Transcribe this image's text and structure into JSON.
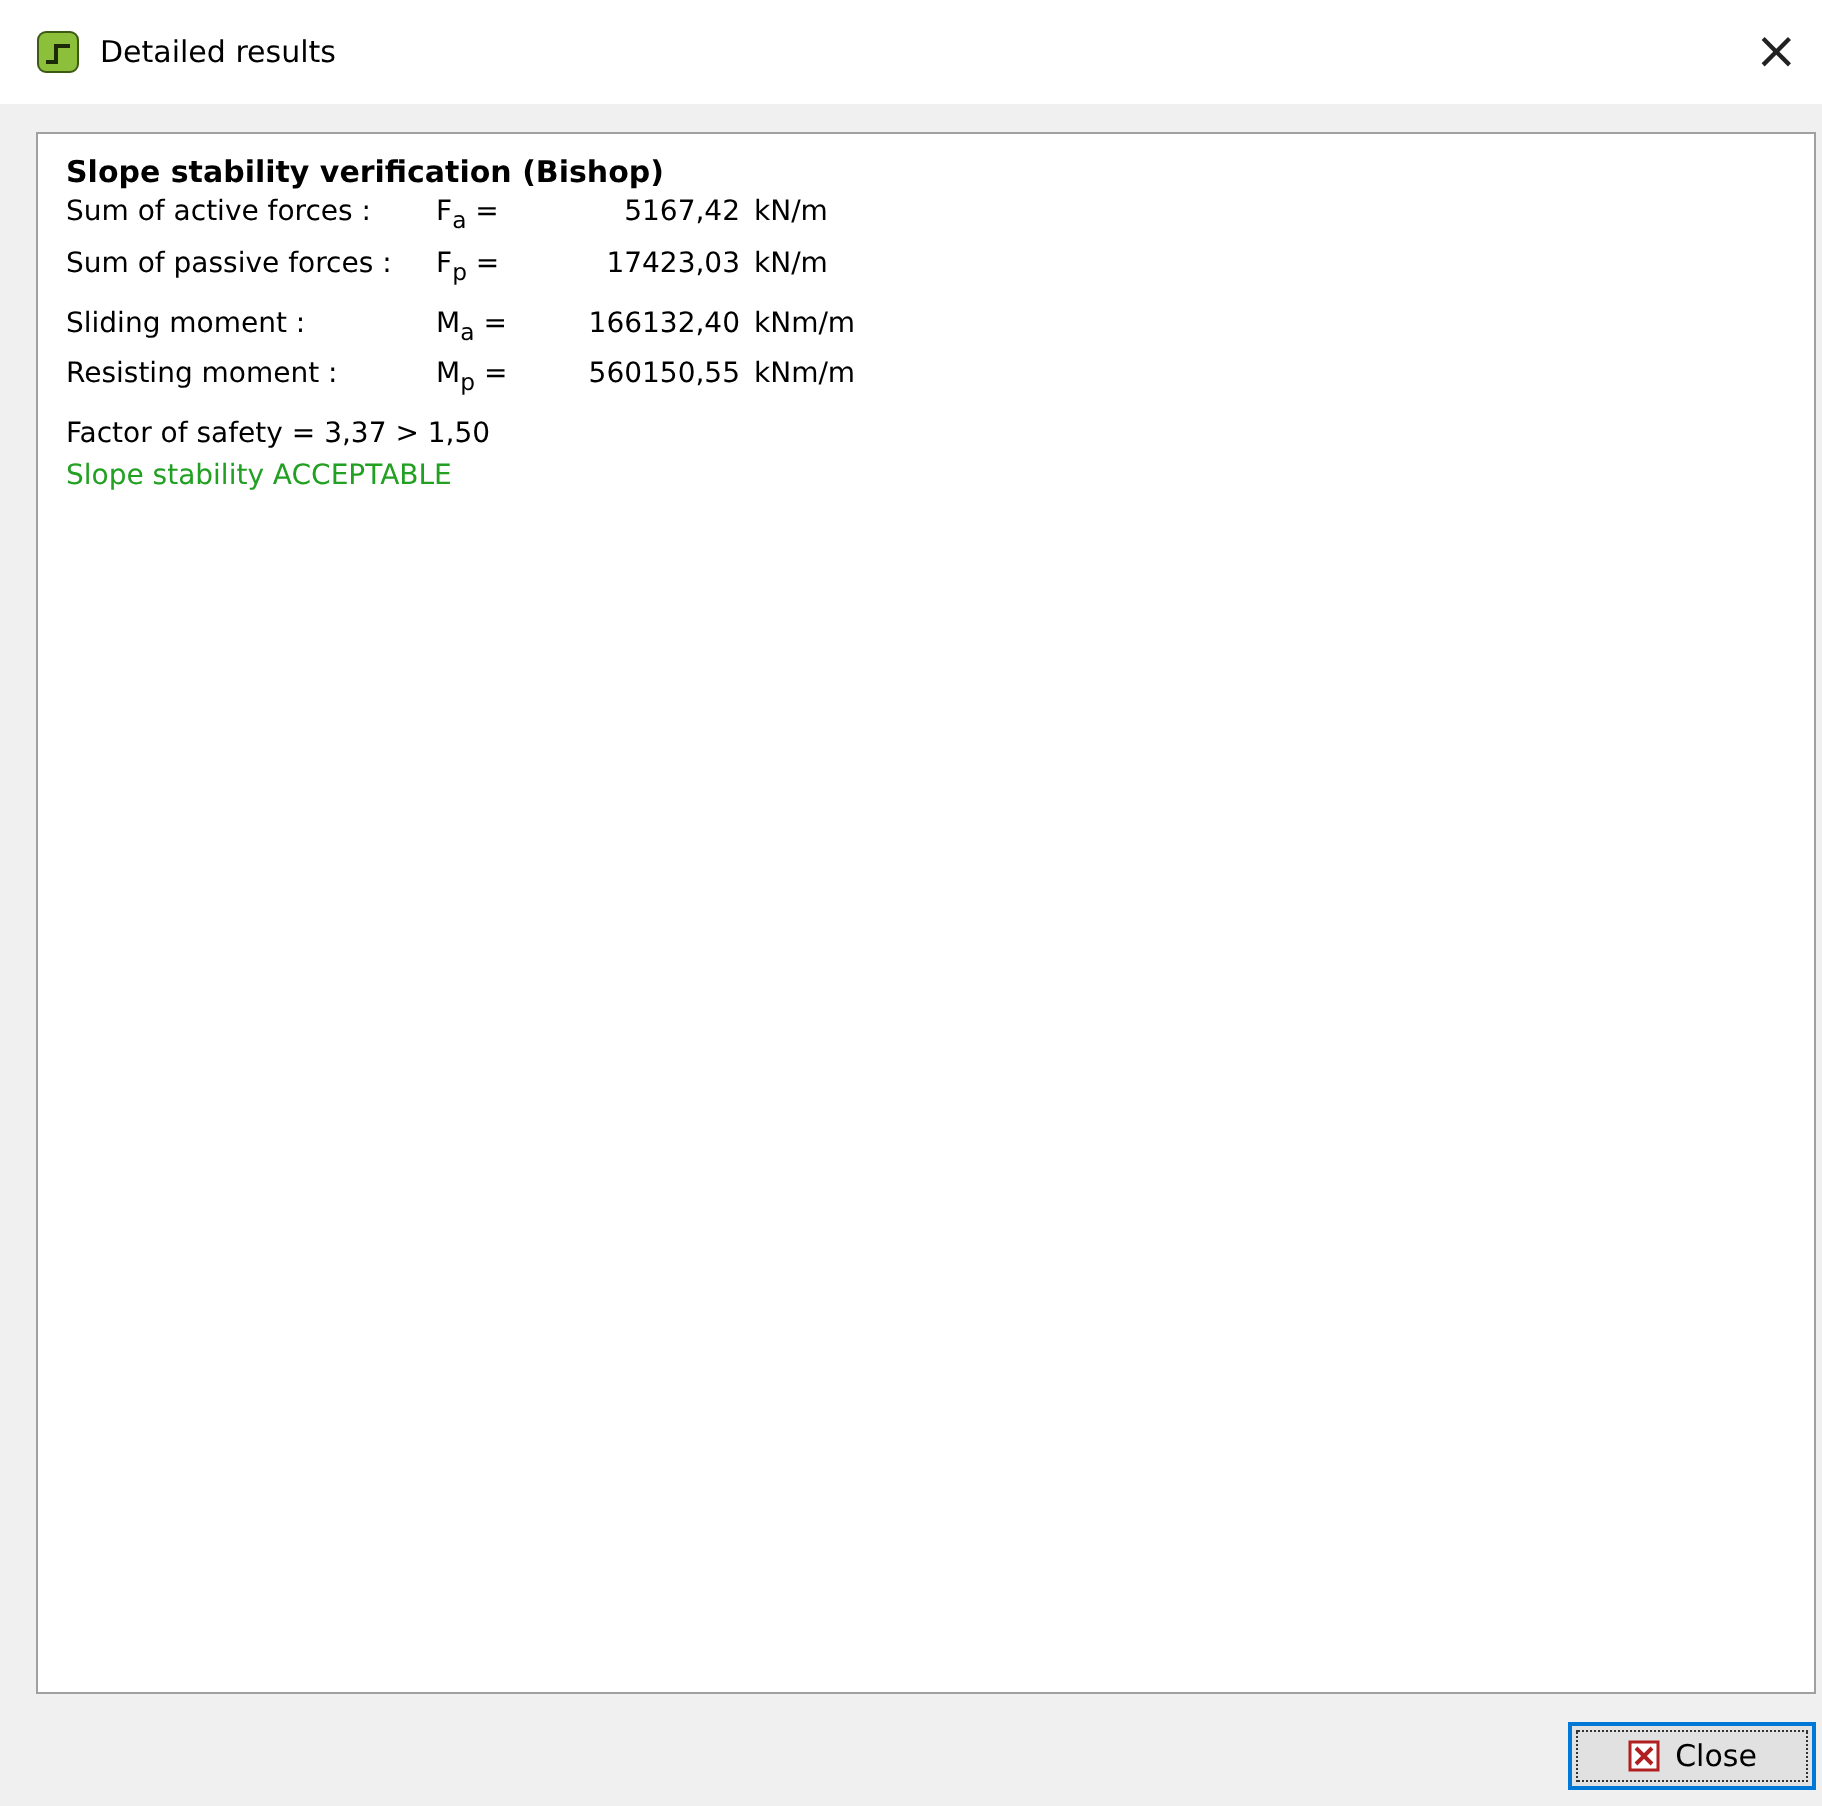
{
  "window": {
    "title": "Detailed results",
    "close_glyph": "×"
  },
  "report": {
    "heading": "Slope stability verification (Bishop)",
    "groups": [
      {
        "rows": [
          {
            "label": "Sum of active forces :",
            "quantity": "F$_{a}$ =",
            "value": "5167,42",
            "unit": "kN/m"
          },
          {
            "label": "Sum of passive forces :",
            "quantity": "F$_{p}$ =",
            "value": "17423,03",
            "unit": "kN/m"
          }
        ]
      },
      {
        "rows": [
          {
            "label": "Sliding moment :",
            "quantity": "M$_{a}$ =",
            "value": "166132,40",
            "unit": "kNm/m"
          },
          {
            "label": "Resisting moment :",
            "quantity": "M$_{p}$ =",
            "value": "560150,55",
            "unit": "kNm/m"
          }
        ]
      }
    ],
    "factor": "Factor of safety = 3,37 > 1,50",
    "verdict": {
      "text": "Slope stability ACCEPTABLE",
      "acceptable": true
    }
  },
  "buttons": [
    {
      "label": "Close",
      "kind": "close"
    }
  ]
}
